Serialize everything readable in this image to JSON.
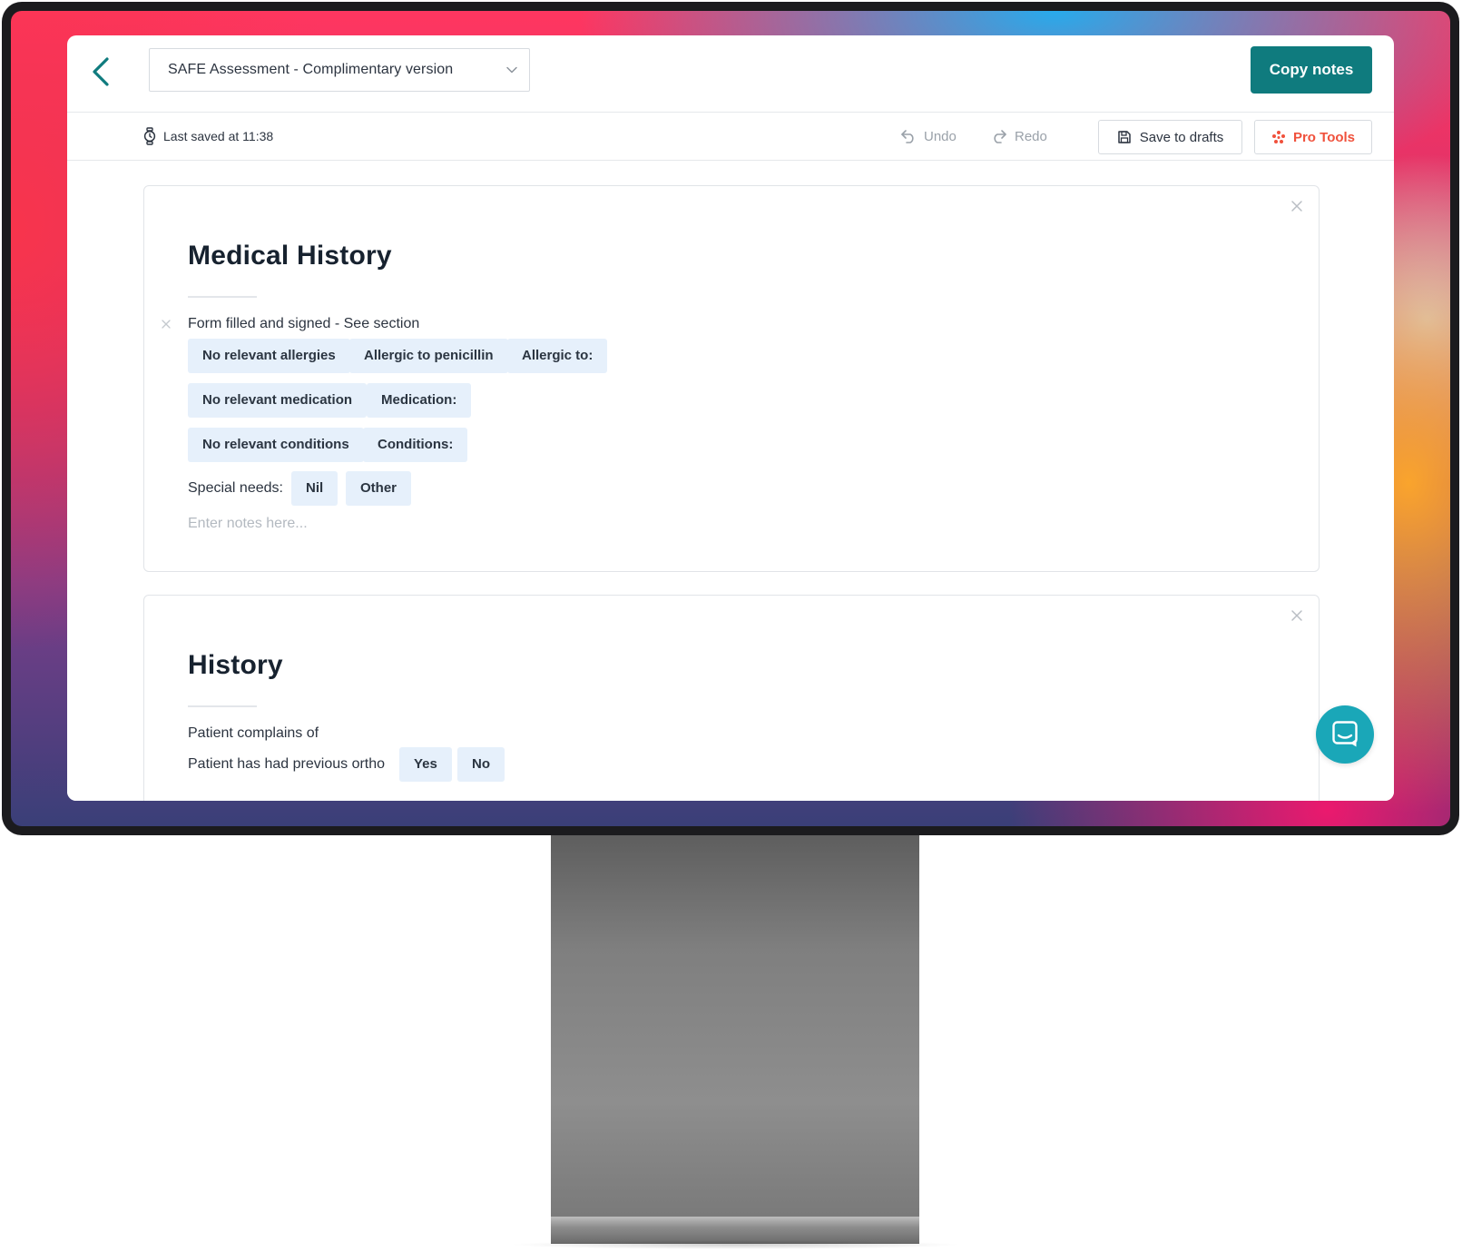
{
  "header": {
    "template_name": "SAFE Assessment - Complimentary version",
    "copy_notes_label": "Copy notes"
  },
  "toolbar": {
    "last_saved": "Last saved at 11:38",
    "undo_label": "Undo",
    "redo_label": "Redo",
    "save_drafts_label": "Save to drafts",
    "pro_tools_label": "Pro Tools"
  },
  "colors": {
    "accent": "#0f7b7e",
    "pro_tools": "#f0513c",
    "chip_bg": "#e6f0fb",
    "chat_button": "#1aa7b8"
  },
  "sections": [
    {
      "title": "Medical History",
      "form_line": "Form filled and signed - See section",
      "chip_rows": [
        [
          "No relevant allergies",
          "Allergic to penicillin",
          "Allergic to:"
        ],
        [
          "No relevant medication",
          "Medication:"
        ],
        [
          "No relevant conditions",
          "Conditions:"
        ]
      ],
      "special_needs_label": "Special needs:",
      "special_needs_options": [
        "Nil",
        "Other"
      ],
      "notes_placeholder": "Enter notes here..."
    },
    {
      "title": "History",
      "complaint_line": "Patient complains of",
      "ortho_line": "Patient has had previous ortho",
      "ortho_options": [
        "Yes",
        "No"
      ]
    }
  ]
}
